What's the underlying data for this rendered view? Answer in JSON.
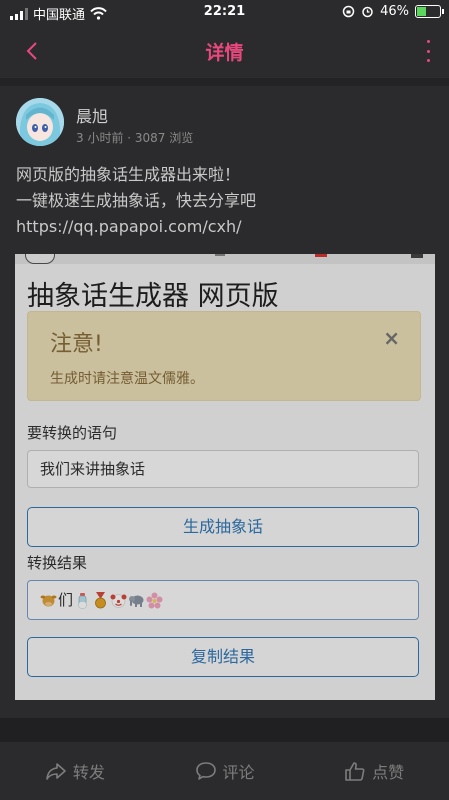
{
  "status_bar": {
    "carrier": "中国联通",
    "time": "22:21",
    "battery": "46%",
    "battery_level": 0.46
  },
  "nav": {
    "title": "详情"
  },
  "post": {
    "author": "晨旭",
    "meta": "3 小时前 · 3087 浏览",
    "lines": [
      "网页版的抽象话生成器出来啦！",
      "一键极速生成抽象话，快去分享吧",
      "https://qq.papapoi.com/cxh/"
    ]
  },
  "screenshot": {
    "title": "抽象话生成器 网页版",
    "alert_title": "注意!",
    "alert_close": "×",
    "alert_text": "生成时请注意温文儒雅。",
    "input_label": "要转换的语句",
    "input_value": "我们来讲抽象话",
    "generate_button": "生成抽象话",
    "result_label": "转换结果",
    "result_text": "们",
    "copy_button": "复制结果"
  },
  "actions": {
    "share": "转发",
    "comment": "评论",
    "like": "点赞"
  }
}
